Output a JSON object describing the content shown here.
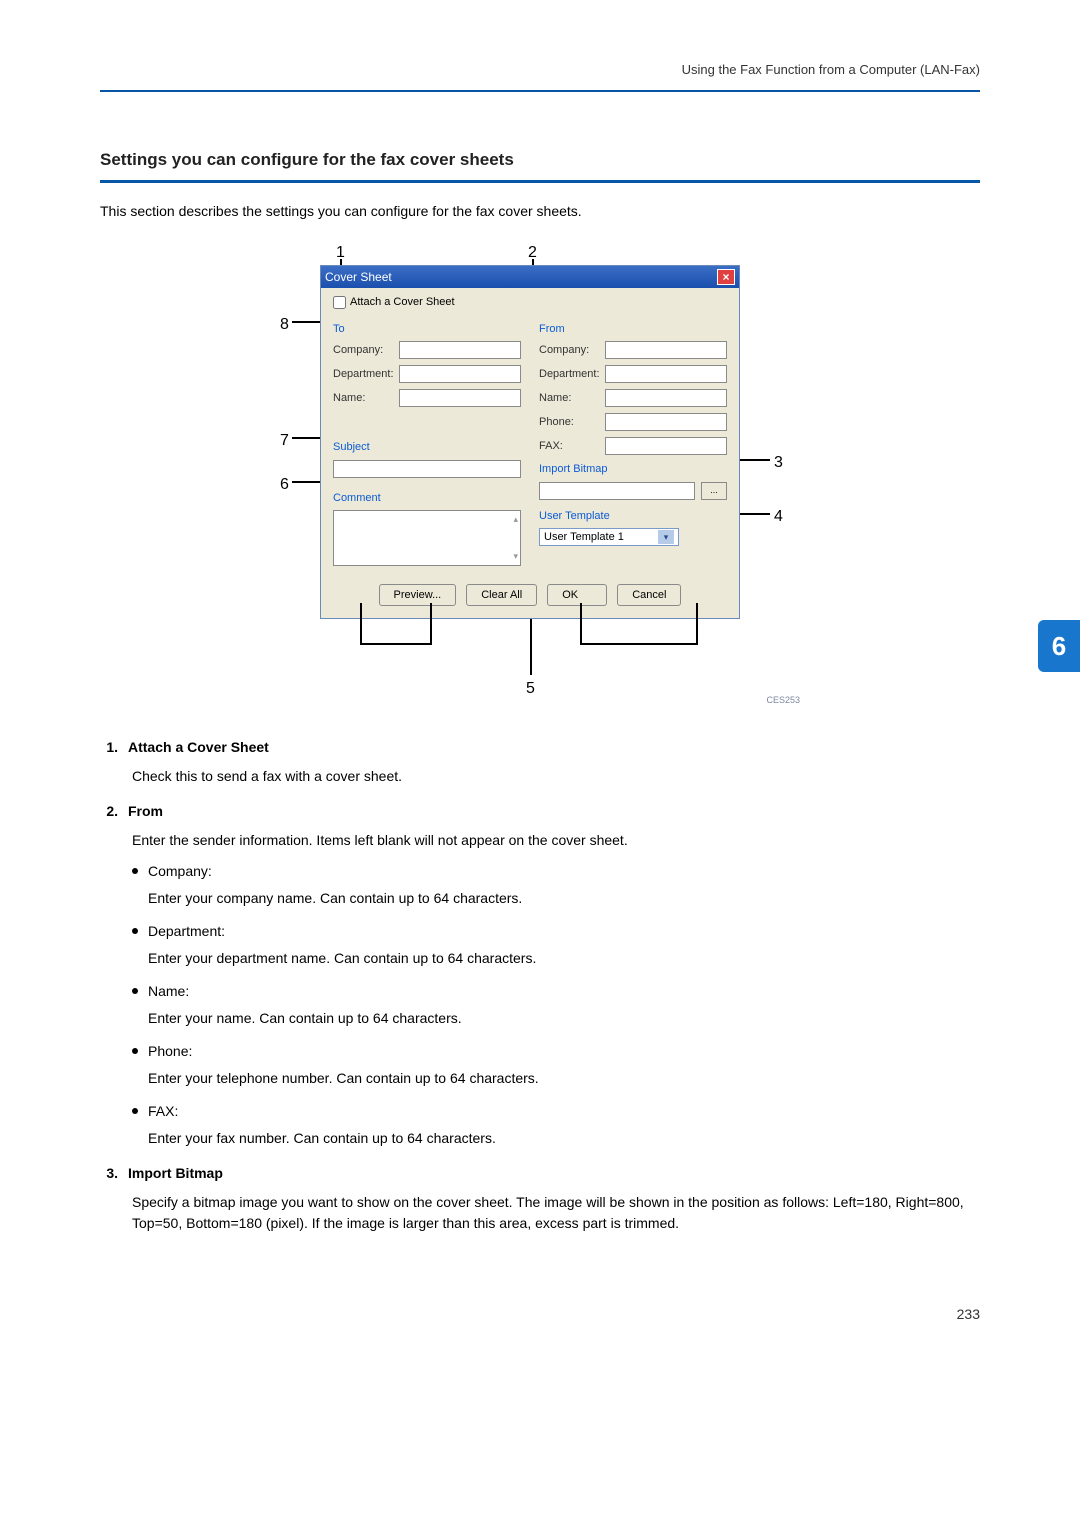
{
  "header": {
    "running_head": "Using the Fax Function from a Computer (LAN-Fax)"
  },
  "section": {
    "title": "Settings you can configure for the fax cover sheets",
    "desc": "This section describes the settings you can configure for the fax cover sheets."
  },
  "chapter_tab": "6",
  "dialog": {
    "title": "Cover Sheet",
    "close": "×",
    "attach_checkbox_label": "Attach a Cover Sheet",
    "to": {
      "heading": "To",
      "company": "Company:",
      "department": "Department:",
      "name": "Name:"
    },
    "from": {
      "heading": "From",
      "company": "Company:",
      "department": "Department:",
      "name": "Name:",
      "phone": "Phone:",
      "fax": "FAX:"
    },
    "subject_heading": "Subject",
    "comment_heading": "Comment",
    "import_bitmap_heading": "Import Bitmap",
    "ellipsis_btn": "...",
    "user_template_heading": "User Template",
    "user_template_value": "User Template 1",
    "buttons": {
      "preview": "Preview...",
      "clear": "Clear All",
      "ok": "OK",
      "cancel": "Cancel"
    },
    "figure_code": "CES253"
  },
  "callouts": {
    "n1": "1",
    "n2": "2",
    "n3": "3",
    "n4": "4",
    "n5": "5",
    "n6": "6",
    "n7": "7",
    "n8": "8"
  },
  "definitions": [
    {
      "num": "1.",
      "title": "Attach a Cover Sheet",
      "body": "Check this to send a fax with a cover sheet."
    },
    {
      "num": "2.",
      "title": "From",
      "body": "Enter the sender information. Items left blank will not appear on the cover sheet.",
      "subs": [
        {
          "label": "Company:",
          "desc": "Enter your company name. Can contain up to 64 characters."
        },
        {
          "label": "Department:",
          "desc": "Enter your department name. Can contain up to 64 characters."
        },
        {
          "label": "Name:",
          "desc": "Enter your name. Can contain up to 64 characters."
        },
        {
          "label": "Phone:",
          "desc": "Enter your telephone number. Can contain up to 64 characters."
        },
        {
          "label": "FAX:",
          "desc": "Enter your fax number. Can contain up to 64 characters."
        }
      ]
    },
    {
      "num": "3.",
      "title": "Import Bitmap",
      "body": "Specify a bitmap image you want to show on the cover sheet. The image will be shown in the position as follows: Left=180, Right=800, Top=50, Bottom=180 (pixel). If the image is larger than this area, excess part is trimmed."
    }
  ],
  "page_number": "233"
}
